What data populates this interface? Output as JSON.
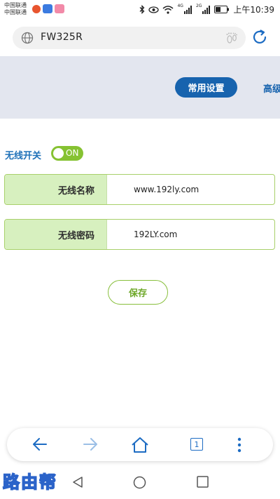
{
  "status_bar": {
    "carrier_1": "中国联通",
    "carrier_2": "中国联通",
    "network_badge_1": "4G",
    "network_badge_2": "2G",
    "time": "上午10:39",
    "icons": [
      "weibo-icon",
      "app-icon",
      "app-icon",
      "bluetooth-icon",
      "eye-icon",
      "wifi-icon",
      "signal-icon",
      "signal-icon",
      "battery-icon"
    ]
  },
  "browser": {
    "url": "FW325R",
    "icons": [
      "globe-icon",
      "footprint-icon",
      "reload-icon"
    ]
  },
  "header": {
    "tab_common": "常用设置",
    "tab_advanced": "高级"
  },
  "wireless": {
    "switch_label": "无线开关",
    "switch_state": "ON",
    "ssid_label": "无线名称",
    "ssid_value": "www.192ly.com",
    "password_label": "无线密码",
    "password_value": "192LY.com",
    "save_label": "保存"
  },
  "toolbar": {
    "tab_count": "1",
    "icons": [
      "back-arrow-icon",
      "forward-arrow-icon",
      "home-icon",
      "tabs-icon",
      "more-icon"
    ]
  },
  "navbar": {
    "watermark": "路由帮",
    "icons": [
      "back-icon",
      "home-circle-icon",
      "recents-icon"
    ]
  },
  "colors": {
    "primary_blue": "#1763ae",
    "accent_green": "#86c232",
    "label_bg": "#d7f0bf",
    "band_bg": "#e3e6ef"
  }
}
